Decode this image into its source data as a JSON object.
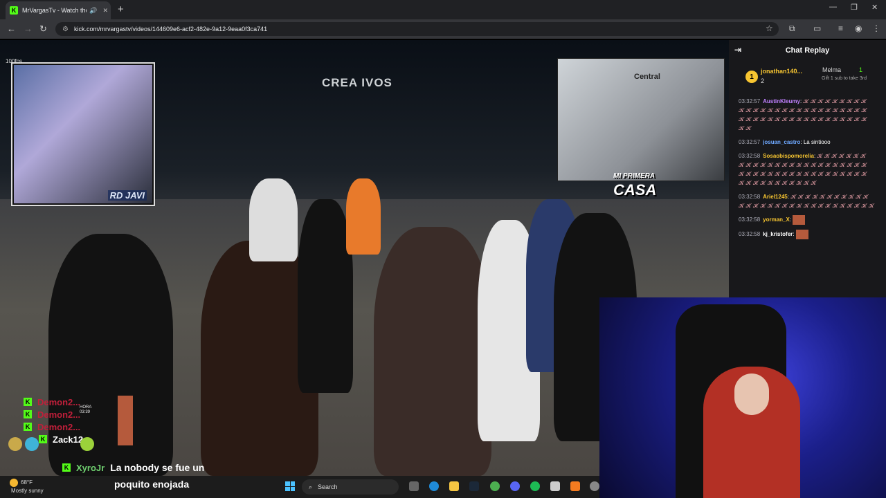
{
  "browser": {
    "tab_title": "MrVargasTv - Watch the VO",
    "favicon": "K",
    "url": "kick.com/mrvargastv/videos/144609e6-acf2-482e-9a12-9eaa0f3ca741"
  },
  "video": {
    "fps": "100fps",
    "watermark": "CREA IVOS",
    "cam1_tag": "RD JAVI",
    "cam2_tag_line1": "MI PRIMERA",
    "cam2_tag_line2": "CASA",
    "cam2_cap": "Central",
    "game_chat": [
      {
        "name": "Demon2...",
        "style": "red"
      },
      {
        "name": "Demon2...",
        "style": "red"
      },
      {
        "name": "Demon2...",
        "style": "red"
      },
      {
        "name": "Zack12",
        "style": "white"
      }
    ],
    "hud_text": "HORA 03:39",
    "overlay_message": {
      "user": "XyroJr",
      "line1": "La nobody se fue un",
      "line2": "poquito enojada"
    }
  },
  "chat": {
    "title": "Chat Replay",
    "leader1": {
      "rank": "1",
      "name": "jonathan140...",
      "count": "2"
    },
    "leader2": {
      "name": "Melma",
      "count": "1",
      "sub": "Gift 1 sub to take 3rd"
    },
    "messages": [
      {
        "time": "03:32:57",
        "user": "AustinKleumy",
        "color": "#c080ff",
        "text": "",
        "emotes": "𝓚𝓚𝓚𝓚𝓚𝓚𝓚𝓚𝓚𝓚𝓚𝓚𝓚𝓚𝓚𝓚𝓚𝓚𝓚𝓚𝓚𝓚𝓚𝓚𝓚𝓚𝓚𝓚𝓚𝓚𝓚𝓚𝓚𝓚𝓚𝓚𝓚𝓚𝓚𝓚𝓚𝓚𝓚𝓚𝓚𝓚𝓚"
      },
      {
        "time": "03:32:57",
        "user": "josuan_castro",
        "color": "#6ea8ff",
        "text": "La sintiooo",
        "emotes": ""
      },
      {
        "time": "03:32:58",
        "user": "Sosaobispomorelia",
        "color": "#f7c531",
        "text": "",
        "emotes": "𝓚𝓚𝓚𝓚𝓚𝓚𝓚𝓚𝓚𝓚𝓚𝓚𝓚𝓚𝓚𝓚𝓚𝓚𝓚𝓚𝓚𝓚𝓚𝓚𝓚𝓚𝓚𝓚𝓚𝓚𝓚𝓚𝓚𝓚𝓚𝓚𝓚𝓚𝓚𝓚𝓚𝓚𝓚𝓚𝓚𝓚𝓚𝓚𝓚𝓚𝓚𝓚𝓚𝓚"
      },
      {
        "time": "03:32:58",
        "user": "Ariel1245",
        "color": "#f7c531",
        "text": "",
        "emotes": "𝓚𝓚𝓚𝓚𝓚𝓚𝓚𝓚𝓚𝓚𝓚𝓚𝓚𝓚𝓚𝓚𝓚𝓚𝓚𝓚𝓚𝓚𝓚𝓚𝓚𝓚𝓚𝓚𝓚𝓚"
      },
      {
        "time": "03:32:58",
        "user": "yorman_X",
        "color": "#f7c531",
        "text": "",
        "emotes": ""
      },
      {
        "time": "03:32:58",
        "user": "kj_kristofer",
        "color": "#ffffff",
        "text": "",
        "emotes": ""
      }
    ]
  },
  "taskbar": {
    "temp": "68°F",
    "condition": "Mostly sunny",
    "search_placeholder": "Search"
  }
}
